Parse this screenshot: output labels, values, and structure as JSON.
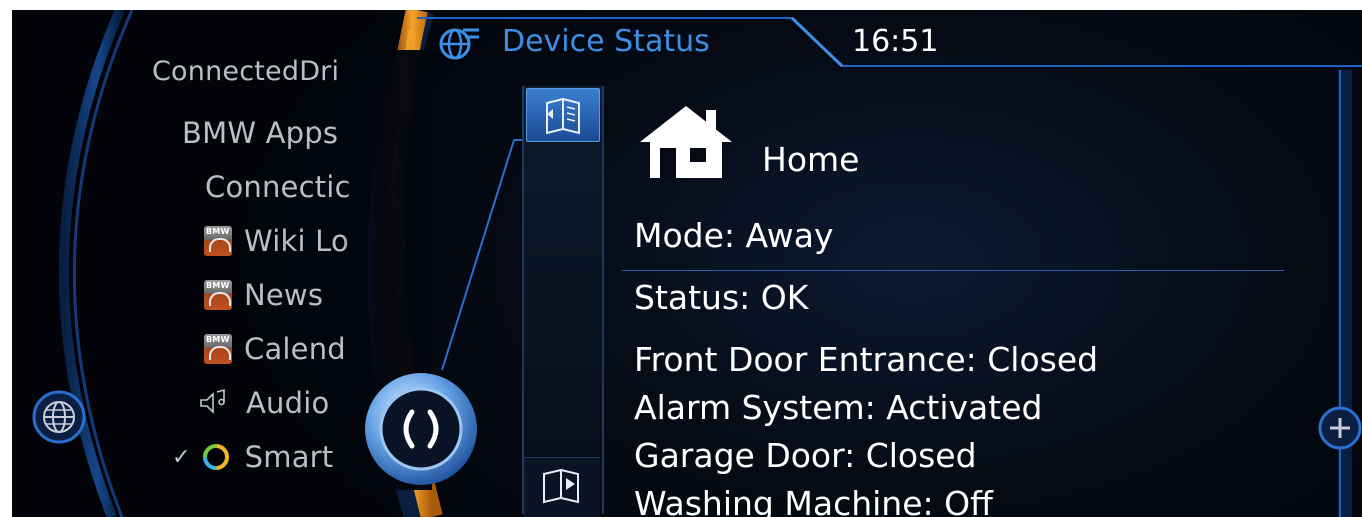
{
  "header": {
    "title": "Device Status",
    "time": "16:51"
  },
  "menu": {
    "items": [
      {
        "label": "ConnectedDri",
        "icon": ""
      },
      {
        "label": "BMW Apps",
        "icon": ""
      },
      {
        "label": "Connectic",
        "icon": ""
      },
      {
        "label": "Wiki Lo",
        "icon": "bmw-app-icon"
      },
      {
        "label": "News",
        "icon": "bmw-app-icon"
      },
      {
        "label": "Calend",
        "icon": "bmw-app-icon"
      },
      {
        "label": "Audio",
        "icon": "audio-icon"
      },
      {
        "label": "Smart",
        "icon": "smart-ring-icon",
        "checked": true
      }
    ],
    "check_mark": "✓"
  },
  "content": {
    "home_label": "Home",
    "mode": "Mode: Away",
    "status": "Status: OK",
    "devices": [
      "Front Door Entrance: Closed",
      "Alarm System: Activated",
      "Garage Door: Closed",
      "Washing Machine: Off"
    ]
  },
  "colors": {
    "accent_blue": "#3d8fe6",
    "orange_arc": "#f39a1e",
    "text_white": "#ffffff",
    "menu_gray": "#b9bfc8"
  }
}
